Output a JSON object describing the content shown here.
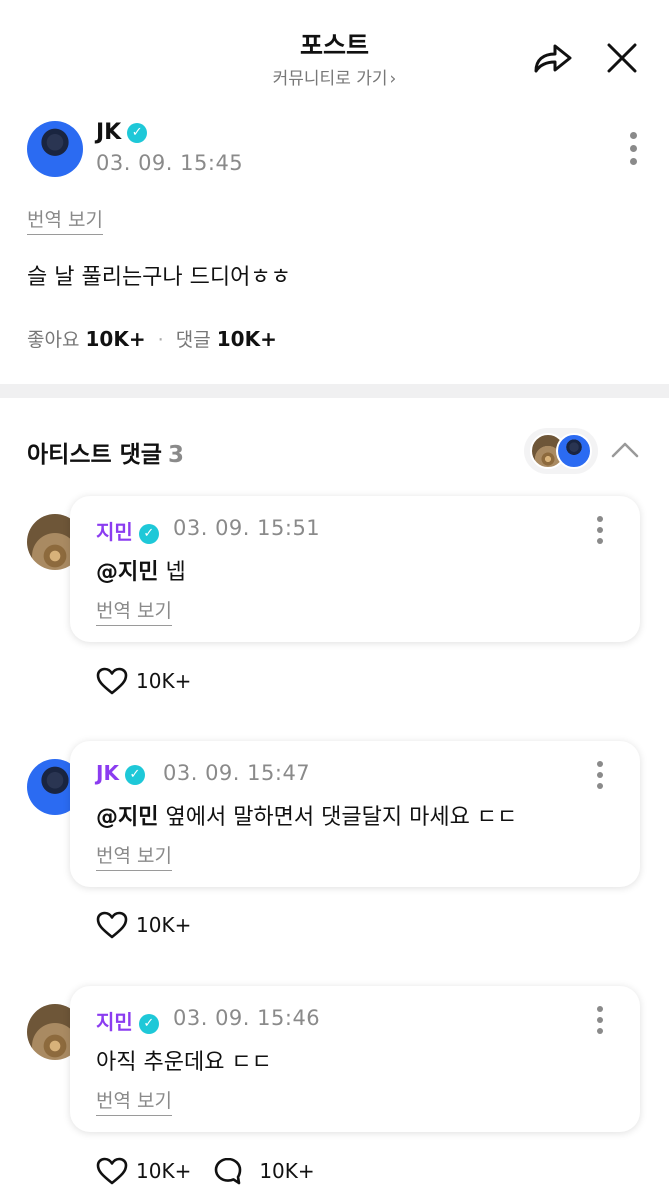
{
  "header": {
    "title": "포스트",
    "subtitle": "커뮤니티로 가기",
    "subtitle_chevron": "›"
  },
  "post": {
    "author": "JK",
    "verified": "✓",
    "date": "03. 09. 15:45",
    "translate_label": "번역 보기",
    "body": "슬 날 풀리는구나 드디어ㅎㅎ",
    "likes_label": "좋아요",
    "likes_value": "10K+",
    "comments_label": "댓글",
    "comments_value": "10K+"
  },
  "artist_comments": {
    "title": "아티스트 댓글",
    "count": "3",
    "items": [
      {
        "author": "지민",
        "date": "03. 09. 15:51",
        "mention": "@지민",
        "text": " 넵",
        "translate_label": "번역 보기",
        "likes": "10K+"
      },
      {
        "author": "JK",
        "date": "03. 09. 15:47",
        "mention": "@지민",
        "text": " 옆에서 말하면서 댓글달지 마세요 ㄷㄷ",
        "translate_label": "번역 보기",
        "likes": "10K+"
      },
      {
        "author": "지민",
        "date": "03. 09. 15:46",
        "mention": "",
        "text": "아직 추운데요 ㄷㄷ",
        "translate_label": "번역 보기",
        "likes": "10K+",
        "replies": "10K+"
      }
    ]
  },
  "colors": {
    "accent_purple": "#8b3cf0",
    "verified_teal": "#1ec8d8",
    "muted_gray": "#8a8a8a"
  },
  "icons": [
    "share-icon",
    "close-icon",
    "more-icon",
    "heart-icon",
    "comment-icon",
    "chevron-up-icon",
    "verified-icon"
  ]
}
